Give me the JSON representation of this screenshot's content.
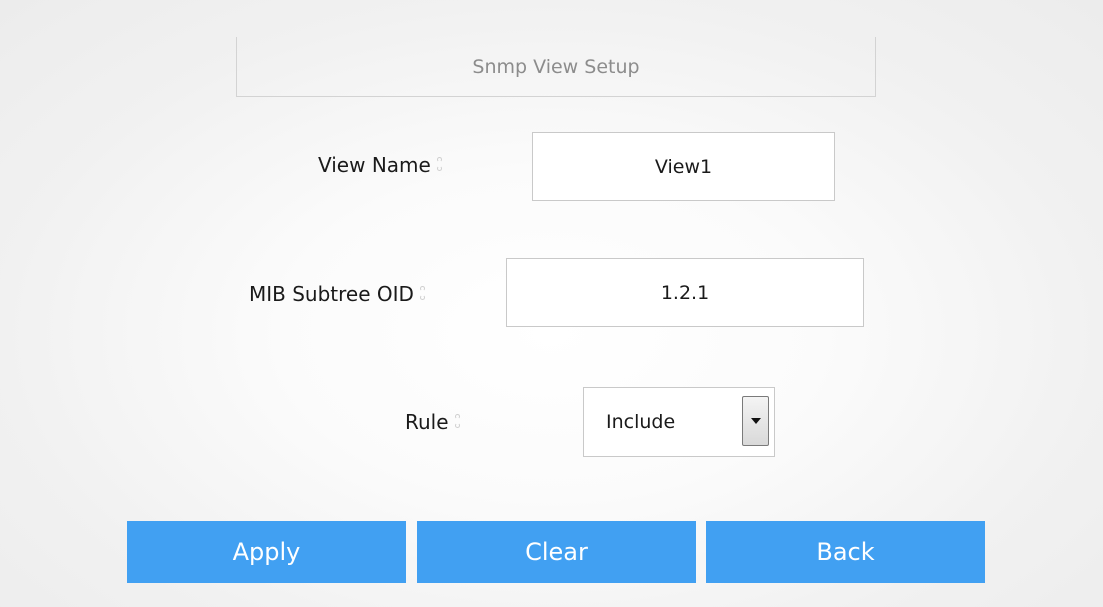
{
  "header": {
    "title": "Snmp View Setup"
  },
  "form": {
    "view_name": {
      "label": "View Name",
      "value": "View1"
    },
    "mib_subtree_oid": {
      "label": "MIB Subtree OID",
      "value": "1.2.1"
    },
    "rule": {
      "label": "Rule",
      "selected": "Include"
    }
  },
  "buttons": {
    "apply": "Apply",
    "clear": "Clear",
    "back": "Back"
  },
  "colors": {
    "button_bg": "#41a0f2",
    "button_text": "#ffffff",
    "header_text": "#8c8c8c"
  },
  "icons": {
    "required_marker": "required-icon",
    "dropdown": "chevron-down-icon"
  }
}
